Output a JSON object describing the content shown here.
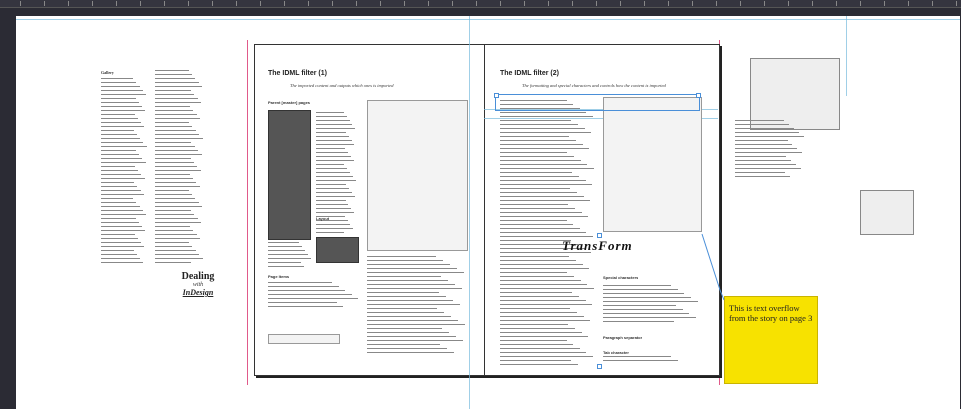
{
  "document": {
    "left_page": {
      "title": "The IDML filter (1)",
      "subtitle": "The imported content and outputs which ones is imported",
      "section_parent": "Parent [master] pages",
      "section_layout": "Layout",
      "section_page_items": "Page Items"
    },
    "right_page": {
      "title": "The IDML filter (2)",
      "subtitle": "The formatting and special characters and controls how the content is imported",
      "section_special": "Special characters",
      "section_para_sep": "Paragraph separator",
      "section_tab": "Tab character"
    },
    "left_story": {
      "heading": "Gallery",
      "signature_line1": "Dealing",
      "signature_line2": "with",
      "signature_line3": "InDesign"
    },
    "transform_logo": "TransForm",
    "overflow_note": "This is text overflow from the story on page 3",
    "colors": {
      "pasteboard": "#2b2b34",
      "page": "#ffffff",
      "guide": "#77bbdd",
      "margin": "#e05a8a",
      "note_fill": "#f7e200",
      "selection": "#4a8fd8"
    },
    "icons": [
      "selection-handle-icon",
      "frame-anchor-icon"
    ]
  }
}
